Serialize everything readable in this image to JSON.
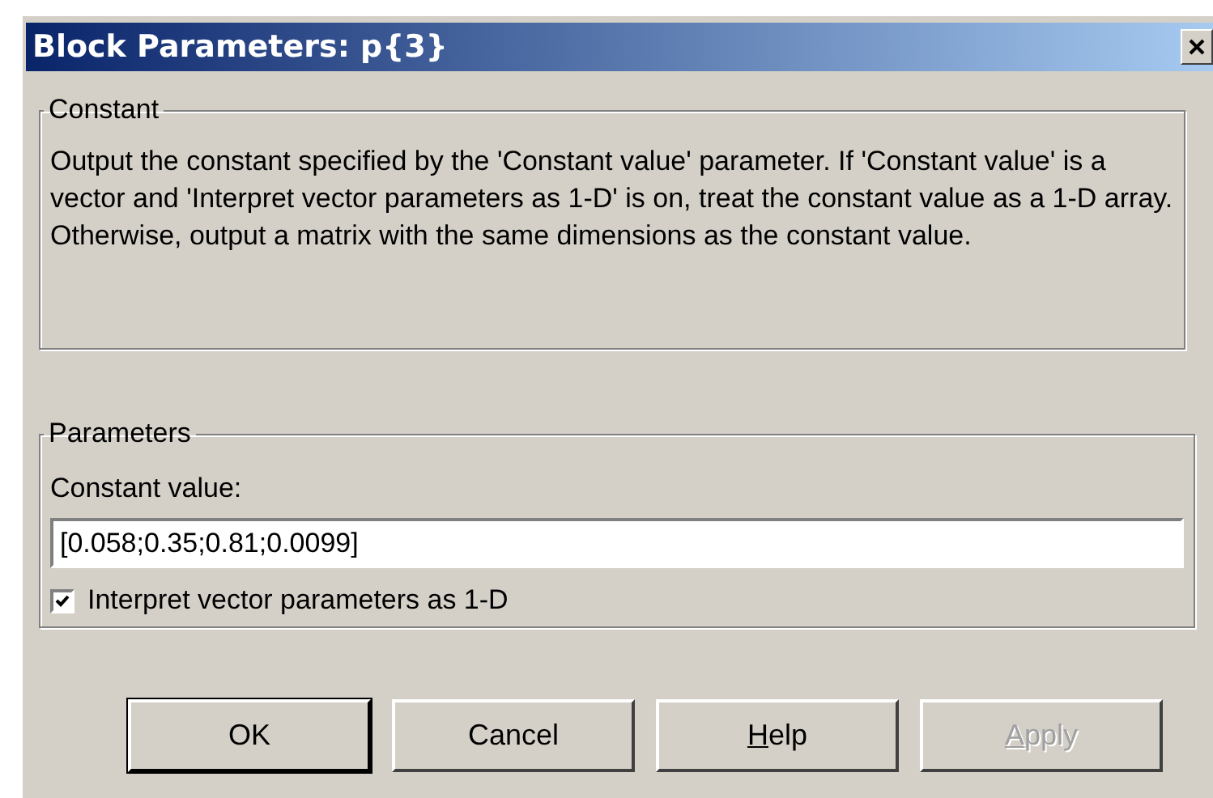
{
  "window": {
    "title": "Block Parameters: p{3}"
  },
  "description_group": {
    "title": "Constant",
    "text": "Output the constant specified by the 'Constant value' parameter. If 'Constant value' is a vector and 'Interpret vector parameters as 1-D' is on, treat the constant value as a 1-D array. Otherwise, output a matrix with the same dimensions as the constant value."
  },
  "parameters_group": {
    "title": "Parameters",
    "field_label": "Constant value:",
    "field_value": "[0.058;0.35;0.81;0.0099]",
    "checkbox": {
      "label": "Interpret vector parameters as 1-D",
      "checked": true
    }
  },
  "buttons": [
    {
      "text": "OK",
      "disabled": false,
      "default": true
    },
    {
      "text": "Cancel",
      "disabled": false,
      "default": false
    },
    {
      "accel": "H",
      "text": "elp",
      "disabled": false,
      "default": false
    },
    {
      "accel": "A",
      "text": "pply",
      "disabled": true,
      "default": false
    }
  ]
}
